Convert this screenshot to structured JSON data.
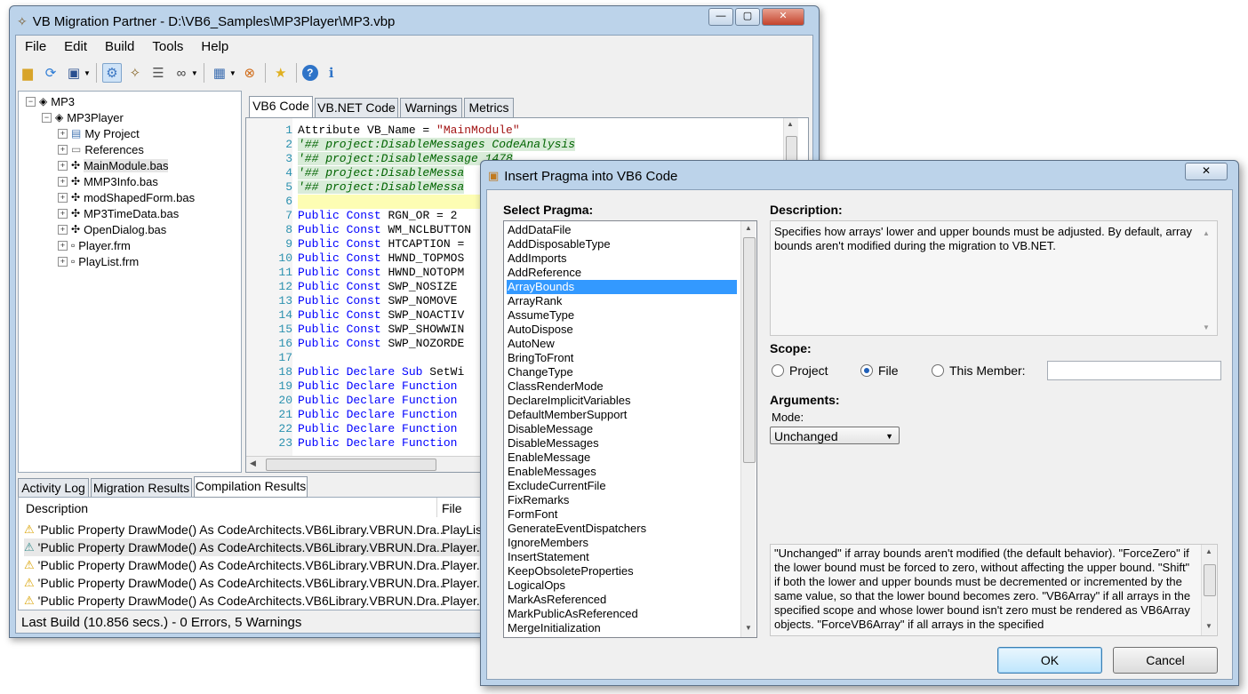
{
  "main_window": {
    "title": "VB Migration Partner - D:\\VB6_Samples\\MP3Player\\MP3.vbp",
    "caption_buttons": {
      "minimize": "—",
      "maximize": "▢",
      "close": "✕"
    }
  },
  "menu": [
    "File",
    "Edit",
    "Build",
    "Tools",
    "Help"
  ],
  "toolbar_icons": [
    "open-folder-icon",
    "refresh-icon",
    "save-icon",
    "settings-icon",
    "wand-icon",
    "stack-icon",
    "binoculars-icon",
    "calendar-icon",
    "chain-icon",
    "star-icon",
    "help-icon",
    "info-icon"
  ],
  "tree": {
    "root": "MP3",
    "project": "MP3Player",
    "items": [
      "My Project",
      "References",
      "MainModule.bas",
      "MMP3Info.bas",
      "modShapedForm.bas",
      "MP3TimeData.bas",
      "OpenDialog.bas",
      "Player.frm",
      "PlayList.frm"
    ]
  },
  "code_tabs": [
    "VB6 Code",
    "VB.NET Code",
    "Warnings",
    "Metrics"
  ],
  "code": {
    "line_numbers": [
      "1",
      "2",
      "3",
      "4",
      "5",
      "6",
      "7",
      "8",
      "9",
      "10",
      "11",
      "12",
      "13",
      "14",
      "15",
      "16",
      "17",
      "18",
      "19",
      "20",
      "21",
      "22",
      "23"
    ],
    "line1": "Attribute VB_Name = ",
    "line1_str": "\"MainModule\"",
    "line2": "'## project:DisableMessages CodeAnalysis",
    "line3": "'## project:DisableMessage 1478",
    "line4": "'## project:DisableMessa",
    "line5": "'## project:DisableMessa",
    "kw_public": "Public",
    "kw_const": "Const",
    "kw_declare": "Declare",
    "kw_sub": "Sub",
    "kw_function": "Function",
    "consts": [
      "RGN_OR = 2",
      "WM_NCLBUTTON",
      "HTCAPTION =",
      "HWND_TOPMOS",
      "HWND_NOTOPM",
      "SWP_NOSIZE",
      "SWP_NOMOVE",
      "SWP_NOACTIV",
      "SWP_SHOWWIN",
      "SWP_NOZORDE"
    ],
    "sub_name": "SetWi"
  },
  "bottom_tabs": [
    "Activity Log",
    "Migration Results",
    "Compilation Results"
  ],
  "results": {
    "headers": {
      "description": "Description",
      "file": "File"
    },
    "rows": [
      {
        "description": "'Public Property DrawMode() As CodeArchitects.VB6Library.VBRUN.Dra...",
        "file": "PlayLis"
      },
      {
        "description": "'Public Property DrawMode() As CodeArchitects.VB6Library.VBRUN.Dra...",
        "file": "Player."
      },
      {
        "description": "'Public Property DrawMode() As CodeArchitects.VB6Library.VBRUN.Dra...",
        "file": "Player."
      },
      {
        "description": "'Public Property DrawMode() As CodeArchitects.VB6Library.VBRUN.Dra...",
        "file": "Player."
      },
      {
        "description": "'Public Property DrawMode() As CodeArchitects.VB6Library.VBRUN.Dra...",
        "file": "Player."
      }
    ]
  },
  "status": "Last Build (10.856 secs.) - 0 Errors, 5 Warnings",
  "dialog": {
    "title": "Insert Pragma into VB6 Code",
    "close": "✕",
    "select_label": "Select Pragma:",
    "pragmas": [
      "AddDataFile",
      "AddDisposableType",
      "AddImports",
      "AddReference",
      "ArrayBounds",
      "ArrayRank",
      "AssumeType",
      "AutoDispose",
      "AutoNew",
      "BringToFront",
      "ChangeType",
      "ClassRenderMode",
      "DeclareImplicitVariables",
      "DefaultMemberSupport",
      "DisableMessage",
      "DisableMessages",
      "EnableMessage",
      "EnableMessages",
      "ExcludeCurrentFile",
      "FixRemarks",
      "FormFont",
      "GenerateEventDispatchers",
      "IgnoreMembers",
      "InsertStatement",
      "KeepObsoleteProperties",
      "LogicalOps",
      "MarkAsReferenced",
      "MarkPublicAsReferenced",
      "MergeInitialization"
    ],
    "selected_pragma": "ArrayBounds",
    "description_label": "Description:",
    "description": "Specifies how arrays' lower and upper bounds must be adjusted. By default, array bounds aren't modified during the migration to VB.NET.",
    "scope_label": "Scope:",
    "scope_options": [
      "Project",
      "File",
      "This Member:"
    ],
    "scope_selected": "File",
    "arguments_label": "Arguments:",
    "mode_label": "Mode:",
    "mode_value": "Unchanged",
    "arguments_help": "\"Unchanged\" if array bounds aren't modified (the default behavior). \"ForceZero\" if the lower bound must be forced to zero, without affecting the upper bound. \"Shift\" if both the lower and upper bounds must be decremented or incremented by the same value, so that the lower bound becomes zero. \"VB6Array\" if all arrays in the specified scope and whose lower bound isn't zero must be rendered as VB6Array objects. \"ForceVB6Array\" if all arrays in the specified",
    "ok": "OK",
    "cancel": "Cancel"
  }
}
